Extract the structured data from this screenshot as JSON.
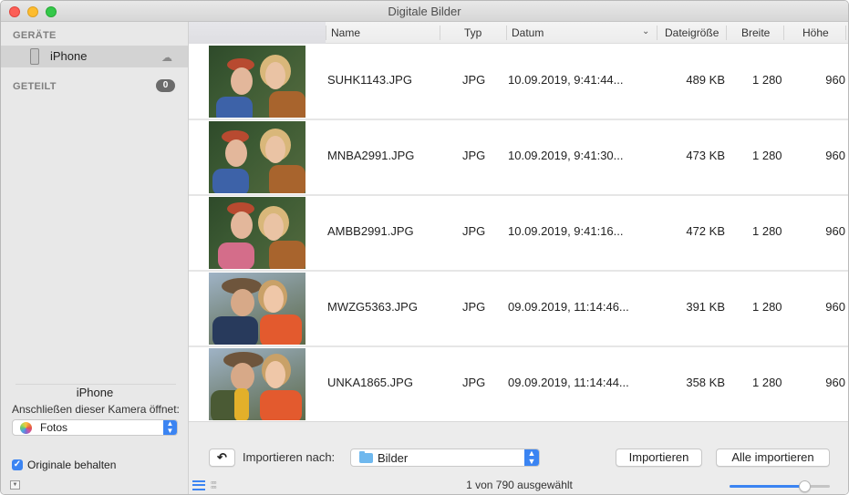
{
  "window": {
    "title": "Digitale Bilder"
  },
  "sidebar": {
    "devices_header": "GERÄTE",
    "device": {
      "name": "iPhone",
      "icon": "iphone-icon",
      "status_icon": "cloud-icon"
    },
    "shared_header": "GETEILT",
    "shared_count": "0",
    "device_panel": {
      "name": "iPhone",
      "opens_label": "Anschließen dieser Kamera öffnet:",
      "opens_app": "Fotos",
      "keep_originals_label": "Originale behalten",
      "keep_originals_checked": true
    }
  },
  "table": {
    "columns": {
      "name": "Name",
      "type": "Typ",
      "date": "Datum",
      "size": "Dateigröße",
      "width": "Breite",
      "height": "Höhe"
    },
    "sort_column": "Datum",
    "rows": [
      {
        "name": "SUHK1143.JPG",
        "type": "JPG",
        "date": "10.09.2019, 9:41:44...",
        "size": "489 KB",
        "width": "1 280",
        "height": "960"
      },
      {
        "name": "MNBA2991.JPG",
        "type": "JPG",
        "date": "10.09.2019, 9:41:30...",
        "size": "473 KB",
        "width": "1 280",
        "height": "960"
      },
      {
        "name": "AMBB2991.JPG",
        "type": "JPG",
        "date": "10.09.2019, 9:41:16...",
        "size": "472 KB",
        "width": "1 280",
        "height": "960"
      },
      {
        "name": "MWZG5363.JPG",
        "type": "JPG",
        "date": "09.09.2019, 11:14:46...",
        "size": "391 KB",
        "width": "1 280",
        "height": "960"
      },
      {
        "name": "UNKA1865.JPG",
        "type": "JPG",
        "date": "09.09.2019, 11:14:44...",
        "size": "358 KB",
        "width": "1 280",
        "height": "960"
      }
    ]
  },
  "bottombar": {
    "rotate_icon": "rotate-left-icon",
    "import_to_label": "Importieren nach:",
    "import_to_value": "Bilder",
    "import_button": "Importieren",
    "import_all_button": "Alle importieren",
    "status": "1 von 790 ausgewählt",
    "thumbnail_size_fraction": 0.78
  },
  "colors": {
    "accent": "#3b84f2",
    "badge": "#6b6b6b"
  }
}
